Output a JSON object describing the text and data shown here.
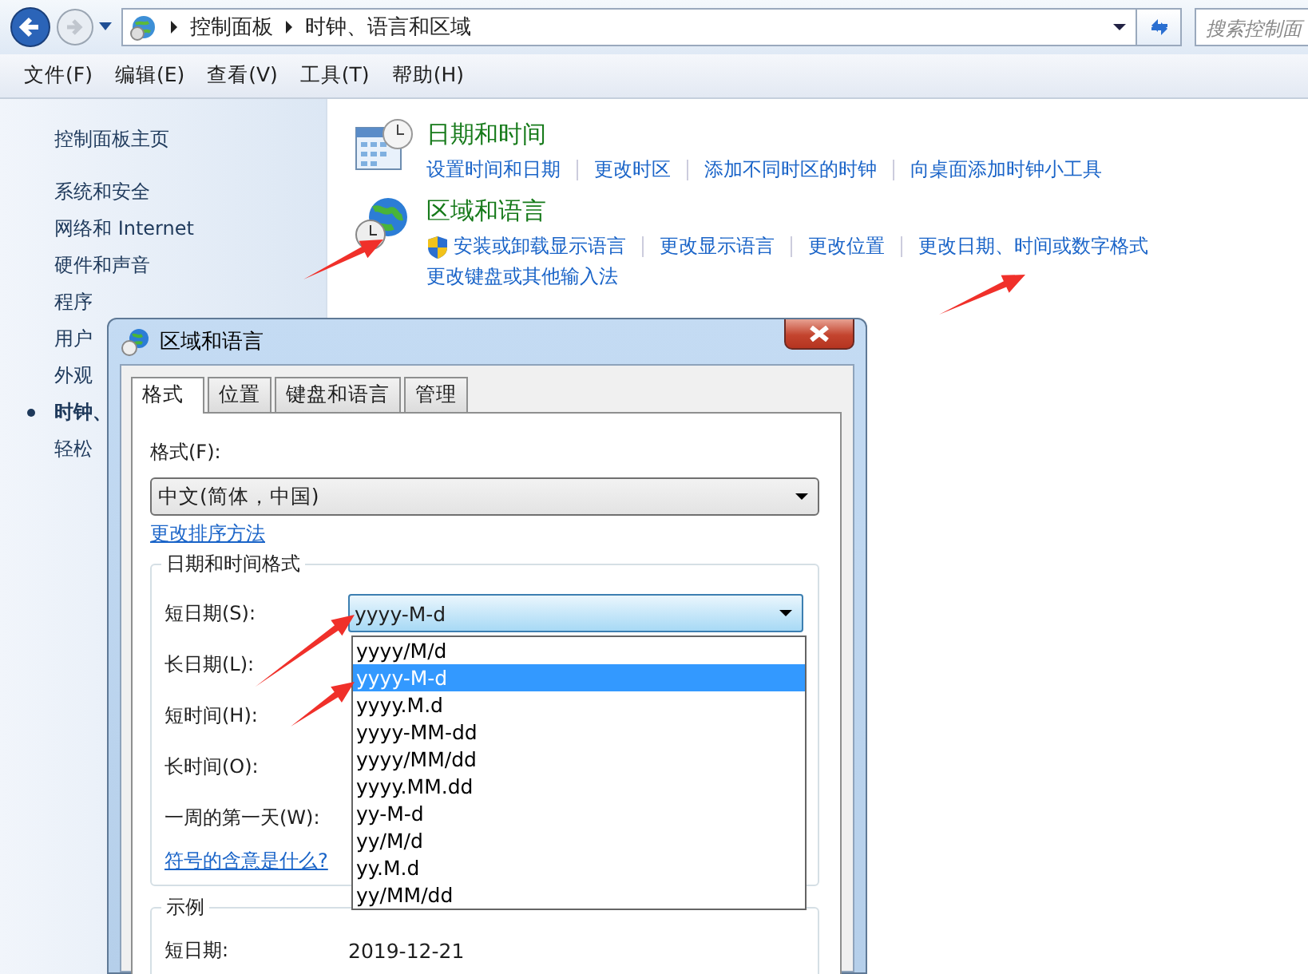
{
  "address_bar": {
    "path": [
      "控制面板",
      "时钟、语言和区域"
    ],
    "search_placeholder": "搜索控制面"
  },
  "menu": [
    "文件(F)",
    "编辑(E)",
    "查看(V)",
    "工具(T)",
    "帮助(H)"
  ],
  "sidebar": {
    "items": [
      {
        "label": "控制面板主页",
        "current": false
      },
      {
        "label": "系统和安全",
        "current": false
      },
      {
        "label": "网络和 Internet",
        "current": false
      },
      {
        "label": "硬件和声音",
        "current": false
      },
      {
        "label": "程序",
        "current": false
      },
      {
        "label": "用户",
        "current": false
      },
      {
        "label": "外观",
        "current": false
      },
      {
        "label": "时钟、",
        "current": true
      },
      {
        "label": "轻松",
        "current": false
      }
    ]
  },
  "categories": [
    {
      "kind": "datetime",
      "title": "日期和时间",
      "lines": [
        [
          {
            "label": "设置时间和日期",
            "shield": false
          },
          {
            "label": "更改时区",
            "shield": false
          },
          {
            "label": "添加不同时区的时钟",
            "shield": false
          },
          {
            "label": "向桌面添加时钟小工具",
            "shield": false
          }
        ]
      ]
    },
    {
      "kind": "region",
      "title": "区域和语言",
      "lines": [
        [
          {
            "label": "安装或卸载显示语言",
            "shield": true
          },
          {
            "label": "更改显示语言",
            "shield": false
          },
          {
            "label": "更改位置",
            "shield": false
          },
          {
            "label": "更改日期、时间或数字格式",
            "shield": false
          }
        ],
        [
          {
            "label": "更改键盘或其他输入法",
            "shield": false
          }
        ]
      ]
    }
  ],
  "dialog": {
    "title": "区域和语言",
    "tabs": [
      {
        "label": "格式",
        "selected": true
      },
      {
        "label": "位置",
        "selected": false
      },
      {
        "label": "键盘和语言",
        "selected": false
      },
      {
        "label": "管理",
        "selected": false
      }
    ],
    "format_label": "格式(F):",
    "format_value": "中文(简体，中国)",
    "sort_link": "更改排序方法",
    "group_title": "日期和时间格式",
    "fields": [
      {
        "label": "短日期(S):",
        "value": "yyyy-M-d",
        "focused": true
      },
      {
        "label": "长日期(L):"
      },
      {
        "label": "短时间(H):"
      },
      {
        "label": "长时间(O):"
      },
      {
        "label": "一周的第一天(W):"
      }
    ],
    "symbols_link": "符号的含意是什么?",
    "dropdown": {
      "options": [
        {
          "label": "yyyy/M/d",
          "selected": false
        },
        {
          "label": "yyyy-M-d",
          "selected": true
        },
        {
          "label": "yyyy.M.d",
          "selected": false
        },
        {
          "label": "yyyy-MM-dd",
          "selected": false
        },
        {
          "label": "yyyy/MM/dd",
          "selected": false
        },
        {
          "label": "yyyy.MM.dd",
          "selected": false
        },
        {
          "label": "yy-M-d",
          "selected": false
        },
        {
          "label": "yy/M/d",
          "selected": false
        },
        {
          "label": "yy.M.d",
          "selected": false
        },
        {
          "label": "yy/MM/dd",
          "selected": false
        }
      ]
    },
    "example": {
      "title": "示例",
      "rows": [
        {
          "label": "短日期:",
          "value": "2019-12-21"
        }
      ]
    }
  }
}
